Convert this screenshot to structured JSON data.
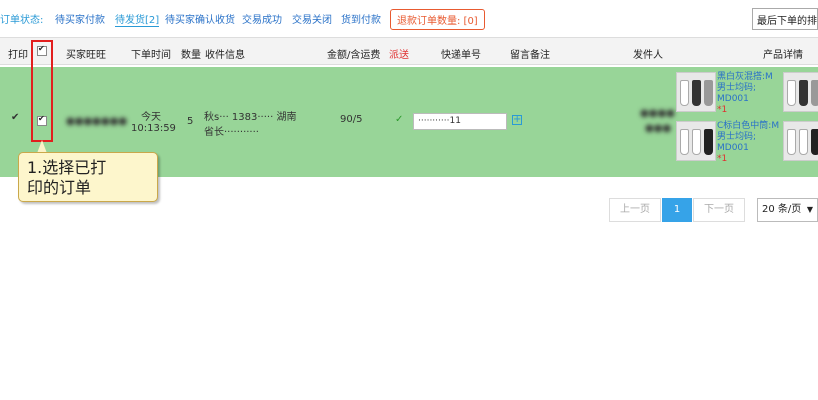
{
  "status_bar": {
    "label": "订单状态:",
    "tabs": [
      {
        "label": "待买家付款"
      },
      {
        "label": "待发货[2]"
      },
      {
        "label": "待买家确认收货"
      },
      {
        "label": "交易成功"
      },
      {
        "label": "交易关闭"
      },
      {
        "label": "货到付款"
      }
    ],
    "refund_label": "退款订单数量: [0]",
    "sort_select": "最后下单的排在"
  },
  "table_header": {
    "print": "打印",
    "buyer": "买家旺旺",
    "order_time": "下单时间",
    "quantity": "数量",
    "recipient": "收件信息",
    "amount": "金额/含运费",
    "dispatch": "派送",
    "tracking": "快递单号",
    "note": "留言备注",
    "sender": "发件人",
    "product": "产品详情"
  },
  "order": {
    "order_day": "今天",
    "order_time": "10:13:59",
    "quantity": "5",
    "recipient_line1": "秋s··· 1383····· 湖南",
    "recipient_line2": "省长···········",
    "amount": "90/5",
    "tracking_value": "···········11",
    "products": [
      {
        "name_line1": "黑白灰混搭:M",
        "name_line2": "男士均码;",
        "sku": "MD001",
        "qty": "*1"
      },
      {
        "name_line1": "C标白色中筒:M",
        "name_line2": "男士均码;",
        "sku": "MD001",
        "qty": "*1"
      }
    ]
  },
  "annotation": {
    "line1": "1.选择已打",
    "line2": "印的订单"
  },
  "pagination": {
    "prev": "上一页",
    "current": "1",
    "next": "下一页",
    "page_size": "20 条/页"
  }
}
